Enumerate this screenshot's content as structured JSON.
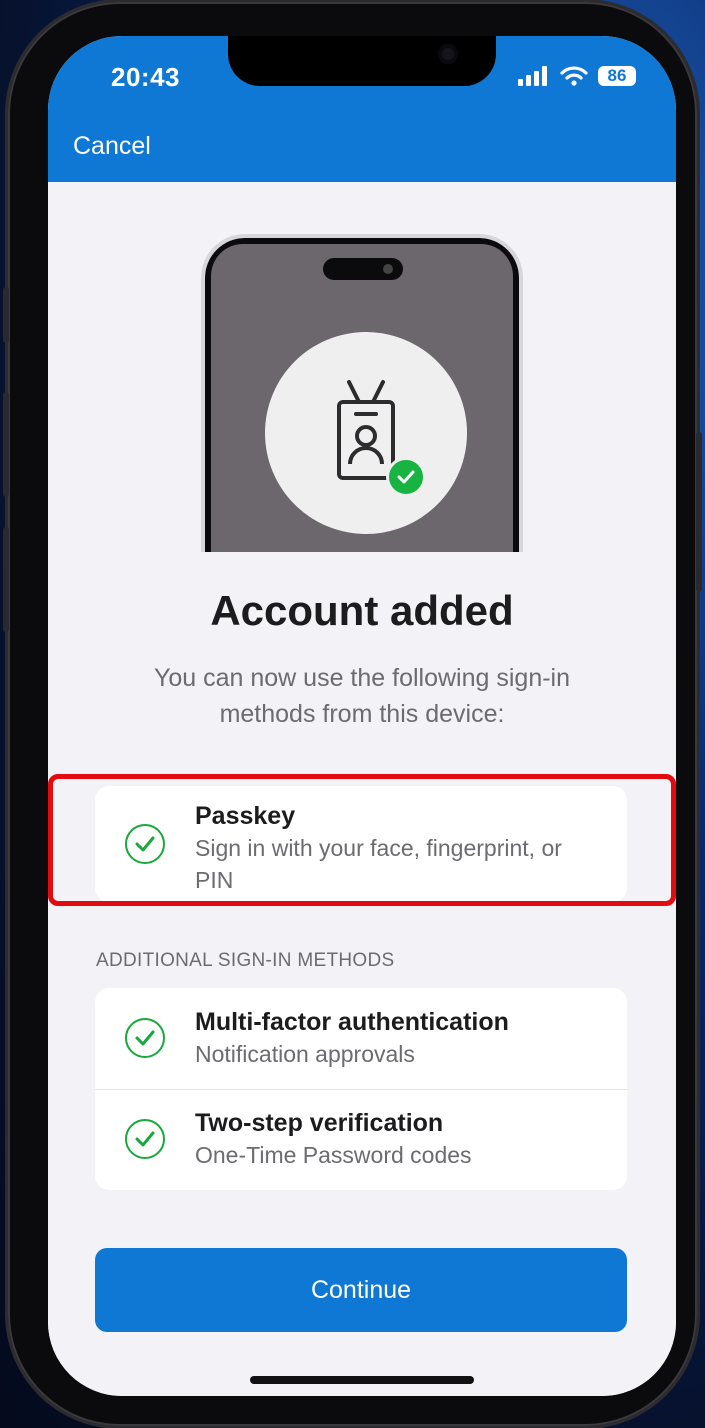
{
  "status_bar": {
    "time": "20:43",
    "battery": "86"
  },
  "nav": {
    "cancel_label": "Cancel"
  },
  "main": {
    "title": "Account added",
    "subtitle": "You can now use the following sign-in methods from this device:"
  },
  "primary_method": {
    "title": "Passkey",
    "subtitle": "Sign in with your face, fingerprint, or PIN"
  },
  "additional": {
    "header": "ADDITIONAL SIGN-IN METHODS",
    "items": [
      {
        "title": "Multi-factor authentication",
        "subtitle": "Notification approvals"
      },
      {
        "title": "Two-step verification",
        "subtitle": "One-Time Password codes"
      }
    ]
  },
  "continue_label": "Continue",
  "colors": {
    "accent": "#0f78d4",
    "success": "#18a93c",
    "highlight": "#e30b0f",
    "background": "#f2f2f7"
  },
  "icons": {
    "signal": "cellular-signal-icon",
    "wifi": "wifi-icon",
    "battery": "battery-icon",
    "illustration": "id-badge-icon",
    "status": "check-circle-icon"
  }
}
